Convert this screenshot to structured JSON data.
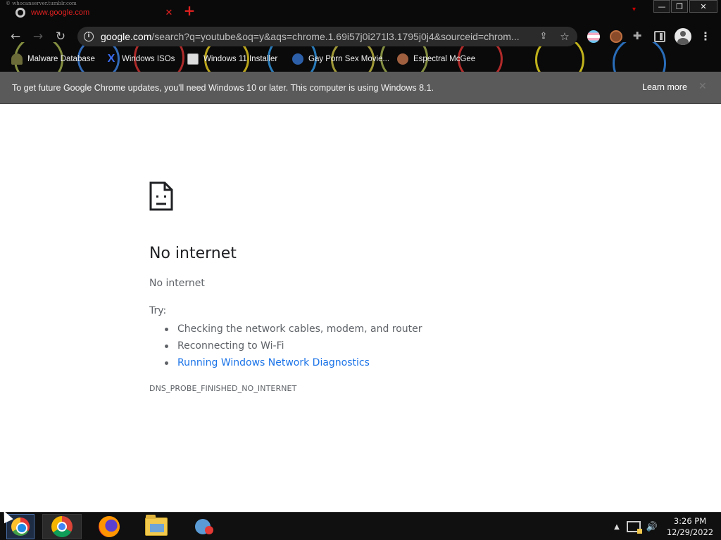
{
  "browser": {
    "tab": {
      "title": "www.google.com",
      "ghost_text": "© whocanserver.tumblr.com",
      "close_glyph": "✕"
    },
    "new_tab_glyph": "+",
    "window_controls": {
      "minimize": "—",
      "maximize": "❐",
      "close": "✕"
    },
    "toolbar": {
      "back_glyph": "←",
      "forward_glyph": "→",
      "reload_glyph": "↻",
      "url_host": "google.com",
      "url_rest": "/search?q=youtube&oq=y&aqs=chrome.1.69i57j0i271l3.1795j0j4&sourceid=chrom..."
    },
    "bookmarks": [
      {
        "label": "Malware Database",
        "icon": "person-icon"
      },
      {
        "label": "Windows ISOs",
        "icon": "x-logo-icon"
      },
      {
        "label": "Windows 11 Installer",
        "icon": "page-icon"
      },
      {
        "label": "Gay Porn Sex Movie...",
        "icon": "site-favicon-icon"
      },
      {
        "label": "Espectral McGee",
        "icon": "avatar-icon"
      }
    ]
  },
  "infobar": {
    "message": "To get future Google Chrome updates, you'll need Windows 10 or later. This computer is using Windows 8.1.",
    "learn_more": "Learn more",
    "close_glyph": "✕"
  },
  "error_page": {
    "title": "No internet",
    "subtitle": "No internet",
    "try_label": "Try:",
    "suggestions": [
      "Checking the network cables, modem, and router",
      "Reconnecting to Wi-Fi",
      "Running Windows Network Diagnostics"
    ],
    "error_code": "DNS_PROBE_FINISHED_NO_INTERNET",
    "colors": {
      "title": "#202124",
      "text": "#5f6368",
      "link": "#1a73e8"
    }
  },
  "taskbar": {
    "apps": [
      "chrome",
      "firefox",
      "file-explorer",
      "messenger"
    ],
    "clock": {
      "time": "3:26 PM",
      "date": "12/29/2022"
    }
  }
}
